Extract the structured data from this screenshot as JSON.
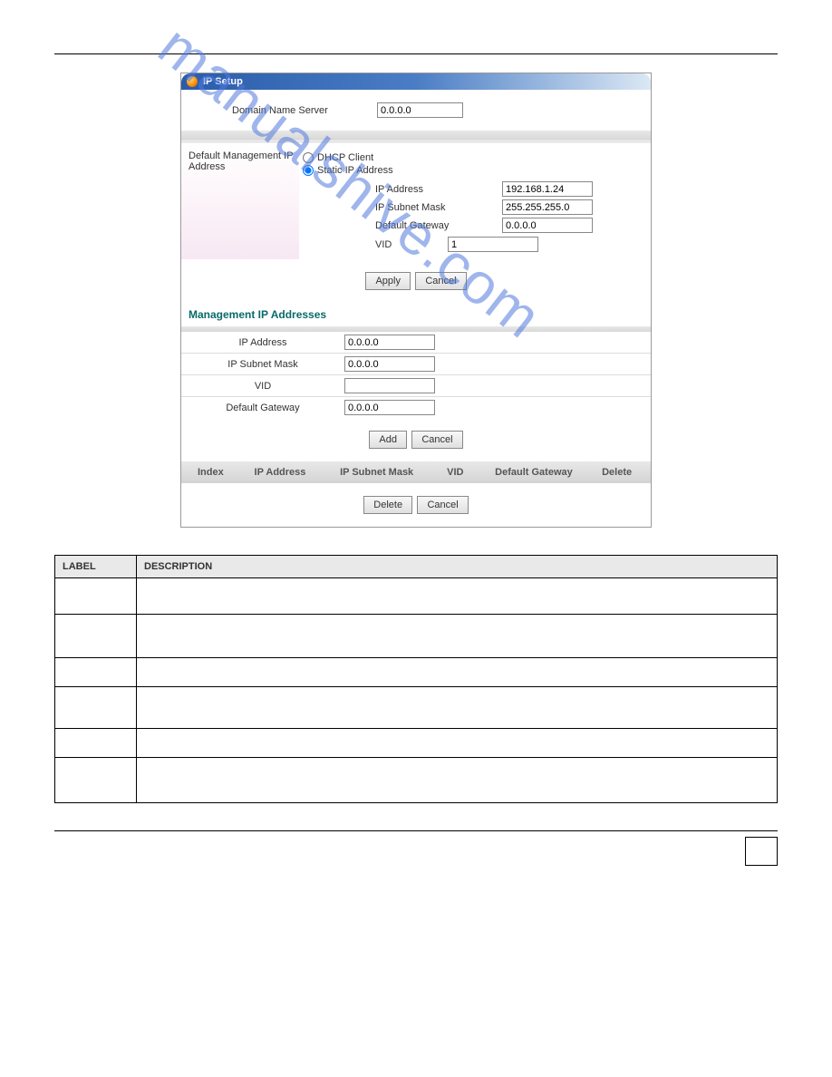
{
  "panel": {
    "title": "IP Setup"
  },
  "dns": {
    "label": "Domain Name Server",
    "value": "0.0.0.0"
  },
  "default_mgmt": {
    "label": "Default Management IP Address",
    "dhcp_label": "DHCP Client",
    "static_label": "Static IP Address",
    "ip_label": "IP Address",
    "ip_value": "192.168.1.24",
    "mask_label": "IP Subnet Mask",
    "mask_value": "255.255.255.0",
    "gw_label": "Default Gateway",
    "gw_value": "0.0.0.0",
    "vid_label": "VID",
    "vid_value": "1"
  },
  "buttons": {
    "apply": "Apply",
    "cancel": "Cancel",
    "add": "Add",
    "delete": "Delete"
  },
  "mgmt_section": {
    "title": "Management IP Addresses",
    "ip_label": "IP Address",
    "ip_value": "0.0.0.0",
    "mask_label": "IP Subnet Mask",
    "mask_value": "0.0.0.0",
    "vid_label": "VID",
    "vid_value": "",
    "gw_label": "Default Gateway",
    "gw_value": "0.0.0.0"
  },
  "table_headers": {
    "index": "Index",
    "ip": "IP Address",
    "mask": "IP Subnet Mask",
    "vid": "VID",
    "gw": "Default Gateway",
    "del": "Delete"
  },
  "watermark": "manualshive.com",
  "desc_table": {
    "head_label": "LABEL",
    "head_desc": "DESCRIPTION",
    "rows": [
      {
        "label": "",
        "desc": ""
      },
      {
        "label": "",
        "desc": ""
      },
      {
        "label": "",
        "desc": ""
      },
      {
        "label": "",
        "desc": ""
      },
      {
        "label": "",
        "desc": ""
      },
      {
        "label": "",
        "desc": ""
      }
    ]
  },
  "page_number": ""
}
